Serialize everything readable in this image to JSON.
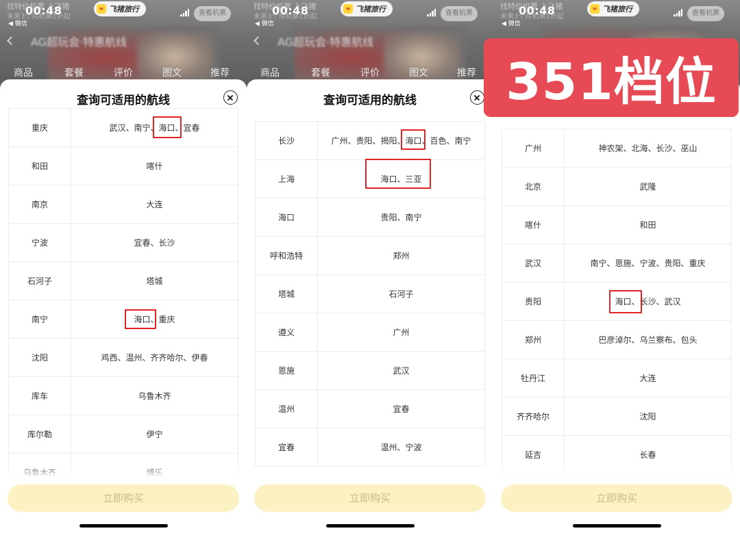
{
  "status_bar": {
    "time": "00:48",
    "back_app": "◀ 微信",
    "app_badge": "飞猪旅行",
    "view_button": "查看机票"
  },
  "background": {
    "promo_line1": "找特价机票 上飞猪",
    "promo_line2": "未来3个月机票1折起",
    "nav_text": "AG超玩会·特惠航线",
    "tabs": [
      "商品",
      "套餐",
      "评价",
      "图文",
      "推荐"
    ]
  },
  "modal": {
    "title": "查询可适用的航线",
    "buy_button": "立即购买"
  },
  "panels": [
    {
      "routes": [
        {
          "from": "重庆",
          "to": "武汉、南宁、海口、宜春"
        },
        {
          "from": "和田",
          "to": "喀什"
        },
        {
          "from": "南京",
          "to": "大连"
        },
        {
          "from": "宁波",
          "to": "宜春、长沙"
        },
        {
          "from": "石河子",
          "to": "塔城"
        },
        {
          "from": "南宁",
          "to": "海口、重庆"
        },
        {
          "from": "沈阳",
          "to": "鸡西、温州、齐齐哈尔、伊春"
        },
        {
          "from": "库车",
          "to": "乌鲁木齐"
        },
        {
          "from": "库尔勒",
          "to": "伊宁"
        },
        {
          "from": "乌鲁木齐",
          "to": "博乐"
        }
      ]
    },
    {
      "routes": [
        {
          "from": "长沙",
          "to": "广州、贵阳、揭阳、海口、百色、南宁"
        },
        {
          "from": "上海",
          "to": "海口、三亚"
        },
        {
          "from": "海口",
          "to": "贵阳、南宁"
        },
        {
          "from": "呼和浩特",
          "to": "郑州"
        },
        {
          "from": "塔城",
          "to": "石河子"
        },
        {
          "from": "遵义",
          "to": "广州"
        },
        {
          "from": "恩施",
          "to": "武汉"
        },
        {
          "from": "温州",
          "to": "宜春"
        },
        {
          "from": "宜春",
          "to": "温州、宁波"
        }
      ]
    },
    {
      "routes": [
        {
          "from": "广州",
          "to": "神农架、北海、长沙、巫山"
        },
        {
          "from": "北京",
          "to": "武隆"
        },
        {
          "from": "喀什",
          "to": "和田"
        },
        {
          "from": "武汉",
          "to": "南宁、恩施、宁波、贵阳、重庆"
        },
        {
          "from": "贵阳",
          "to": "海口、长沙、武汉"
        },
        {
          "from": "郑州",
          "to": "巴彦淖尔、乌兰察布、包头"
        },
        {
          "from": "牡丹江",
          "to": "大连"
        },
        {
          "from": "齐齐哈尔",
          "to": "沈阳"
        },
        {
          "from": "延吉",
          "to": "长春"
        }
      ]
    }
  ],
  "overlay_badge": "351档位",
  "colors": {
    "highlight": "#e02424",
    "badge": "#e64a55",
    "buy_button_bg": "#fcf1c2",
    "buy_button_text": "#cab98b"
  }
}
